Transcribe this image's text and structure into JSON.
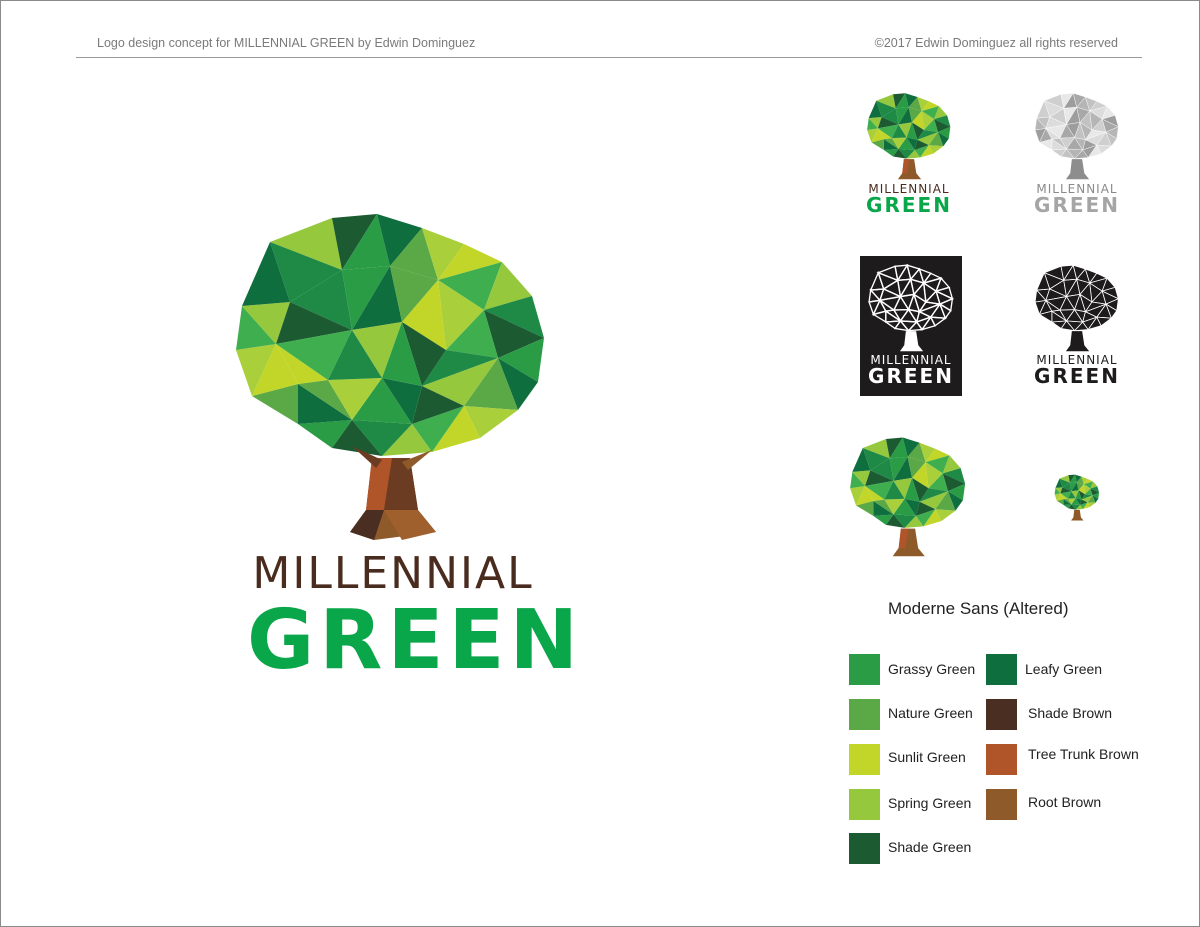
{
  "header": {
    "left_text": "Logo design concept for MILLENNIAL GREEN by Edwin Dominguez",
    "right_text": "©2017 Edwin Dominguez all rights reserved"
  },
  "logo": {
    "line1": "MILLENNIAL",
    "line2": "GREEN"
  },
  "font_name": "Moderne Sans (Altered)",
  "palette": [
    {
      "name": "Grassy Green",
      "color": "#2a9c46"
    },
    {
      "name": "Nature Green",
      "color": "#5aa846"
    },
    {
      "name": "Sunlit Green",
      "color": "#c2d62a"
    },
    {
      "name": "Spring Green",
      "color": "#96c83e"
    },
    {
      "name": "Shade Green",
      "color": "#1c5a32"
    },
    {
      "name": "Leafy Green",
      "color": "#0f6e3e"
    },
    {
      "name": "Shade Brown",
      "color": "#4b2e22"
    },
    {
      "name": "Tree Trunk Brown",
      "color": "#b0552a"
    },
    {
      "name": "Root Brown",
      "color": "#8f5a2a"
    }
  ],
  "colors": {
    "wordmark_brown": "#4a2c1f",
    "wordmark_green": "#0aa64a",
    "grey": "#9a9a9a",
    "black": "#1d1b1b"
  }
}
